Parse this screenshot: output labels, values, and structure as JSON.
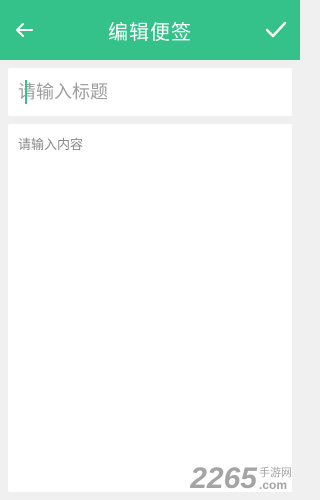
{
  "header": {
    "title": "编辑便签",
    "back_icon": "arrow-left-icon",
    "confirm_icon": "checkmark-icon",
    "color": "#35c28a"
  },
  "form": {
    "title_placeholder": "请输入标题",
    "title_value": "",
    "content_placeholder": "请输入内容",
    "content_value": ""
  },
  "watermark": {
    "number": "2265",
    "suffix_top": "手游网",
    "suffix_bottom": ".com"
  }
}
